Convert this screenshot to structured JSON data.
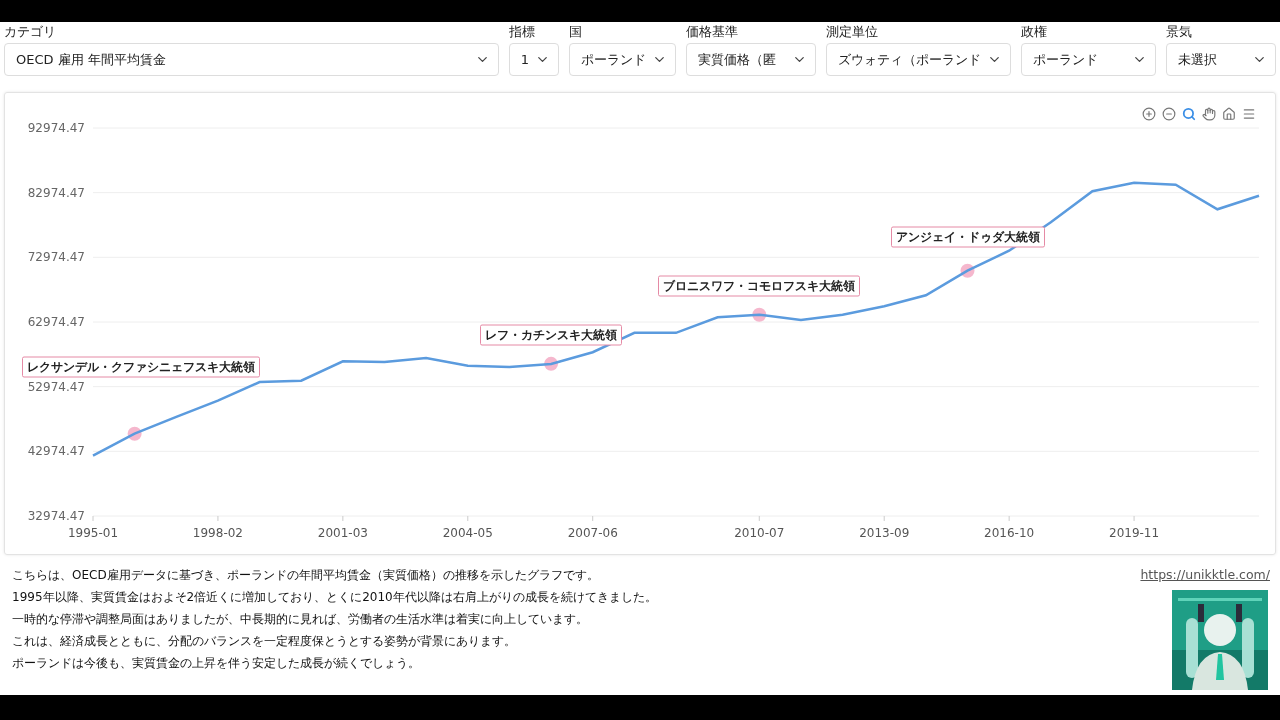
{
  "filters": [
    {
      "label": "カテゴリ",
      "value": "OECD 雇用 年間平均賃金"
    },
    {
      "label": "指標",
      "value": "1"
    },
    {
      "label": "国",
      "value": "ポーランド"
    },
    {
      "label": "価格基準",
      "value": "実質価格（匿"
    },
    {
      "label": "測定単位",
      "value": "ズウォティ（ポーランド"
    },
    {
      "label": "政権",
      "value": "ポーランド"
    },
    {
      "label": "景気",
      "value": "未選択"
    }
  ],
  "toolbar": [
    {
      "kind": "zoom_in",
      "selected": false
    },
    {
      "kind": "zoom_out",
      "selected": false
    },
    {
      "kind": "zoom",
      "selected": true
    },
    {
      "kind": "pan",
      "selected": false
    },
    {
      "kind": "home",
      "selected": false
    },
    {
      "kind": "menu",
      "selected": false
    }
  ],
  "chart_data": {
    "type": "line",
    "categories": [
      "1995-01",
      null,
      null,
      "1998-02",
      null,
      null,
      "2001-03",
      null,
      null,
      "2004-05",
      null,
      null,
      "2007-06",
      null,
      null,
      null,
      "2010-07",
      null,
      null,
      "2013-09",
      null,
      null,
      "2016-10",
      null,
      null,
      "2019-11",
      null,
      null,
      null
    ],
    "grid": true,
    "series": [
      {
        "color": "#5b9bde",
        "values": [
          42300,
          45700,
          48300,
          50800,
          53700,
          53900,
          56900,
          56800,
          57400,
          56200,
          56000,
          56500,
          58300,
          61300,
          61300,
          63700,
          64100,
          63300,
          64100,
          65400,
          67100,
          70900,
          74000,
          78400,
          83200,
          84500,
          84200,
          80400,
          82500
        ]
      }
    ],
    "ylim": [
      32974.47,
      92974.47
    ],
    "yticks": [
      {
        "value": 32974.47,
        "label": "32974.47"
      },
      {
        "value": 42974.47,
        "label": "42974.47"
      },
      {
        "value": 52974.47,
        "label": "52974.47"
      },
      {
        "value": 62974.47,
        "label": "62974.47"
      },
      {
        "value": 72974.47,
        "label": "72974.47"
      },
      {
        "value": 82974.47,
        "label": "82974.47"
      },
      {
        "value": 92974.47,
        "label": "92974.47"
      }
    ],
    "annotations": [
      "レクサンデル・クファシニェフスキ大統領",
      "レフ・カチンスキ大統領",
      "ブロニスワフ・コモロフスキ大統領",
      "アンジェイ・ドゥダ大統領"
    ]
  },
  "description": [
    "こちらは、OECD雇用データに基づき、ポーランドの年間平均賃金（実質価格）の推移を示したグラフです。",
    "1995年以降、実質賃金はおよそ2倍近くに増加しており、とくに2010年代以降は右肩上がりの成長を続けてきました。",
    "一時的な停滞や調整局面はありましたが、中長期的に見れば、労働者の生活水準は着実に向上しています。",
    "これは、経済成長とともに、分配のバランスを一定程度保とうとする姿勢が背景にあります。",
    "ポーランドは今後も、実質賃金の上昇を伴う安定した成長が続くでしょう。"
  ],
  "link": "https://unikktle.com/",
  "thumbnail": {
    "kind": "picture"
  }
}
